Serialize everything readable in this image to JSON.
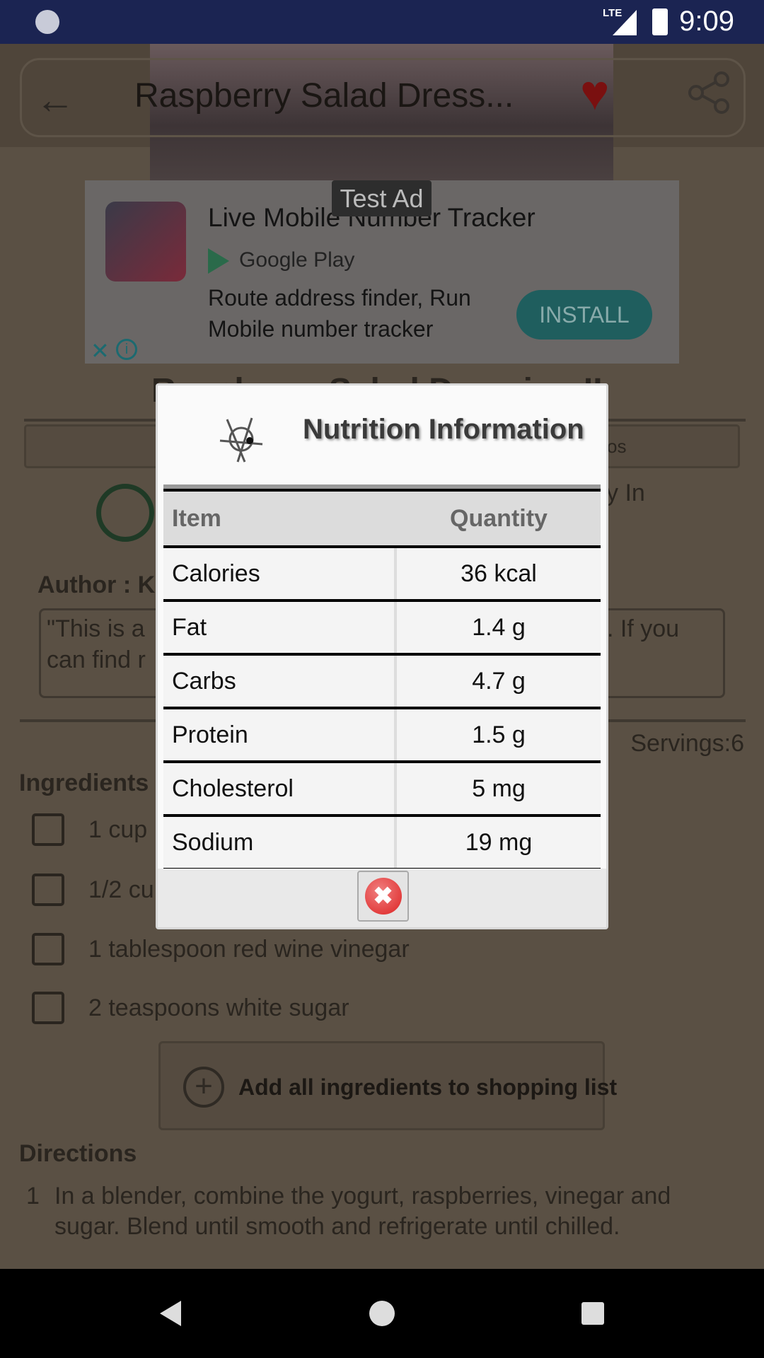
{
  "status_bar": {
    "time": "9:09",
    "network": "LTE"
  },
  "toolbar": {
    "title": "Raspberry Salad Dress...",
    "back_icon": "arrow-left-icon",
    "favorite_icon": "heart-icon",
    "share_icon": "share-icon"
  },
  "ad": {
    "badge": "Test Ad",
    "title": "Live Mobile Number Tracker",
    "store": "Google Play",
    "description_line1": "Route address finder, Run",
    "description_line2": "Mobile number tracker",
    "install_label": "INSTALL",
    "accent": "#1f5e5e"
  },
  "recipe": {
    "title": "Raspberry Salad Dressing II",
    "tab_fragment": "os",
    "ready_fragment": "y In",
    "author_fragment": "Author : K",
    "desc_fragment_1": "\"This is a",
    "desc_fragment_2": "can find r",
    "desc_fragment_3": ".  If you",
    "servings": "Servings:6",
    "ingredients_heading": "Ingredients",
    "ingredients": [
      "1 cup",
      "1/2 cu",
      "1 tablespoon red wine vinegar",
      "2 teaspoons white sugar"
    ],
    "add_all_label": "Add all ingredients to shopping list",
    "directions_heading": "Directions",
    "directions": [
      {
        "num": "1",
        "line1": "In a blender, combine the yogurt, raspberries, vinegar and",
        "line2": "sugar. Blend until smooth and refrigerate until chilled."
      }
    ]
  },
  "dialog": {
    "title": "Nutrition Information",
    "header": {
      "item": "Item",
      "quantity": "Quantity"
    },
    "rows": [
      {
        "item": "Calories",
        "quantity": "36 kcal"
      },
      {
        "item": "Fat",
        "quantity": "1.4 g"
      },
      {
        "item": "Carbs",
        "quantity": "4.7 g"
      },
      {
        "item": "Protein",
        "quantity": "1.5 g"
      },
      {
        "item": "Cholesterol",
        "quantity": "5 mg"
      },
      {
        "item": "Sodium",
        "quantity": "19 mg"
      }
    ],
    "close_icon": "close-x-icon"
  }
}
